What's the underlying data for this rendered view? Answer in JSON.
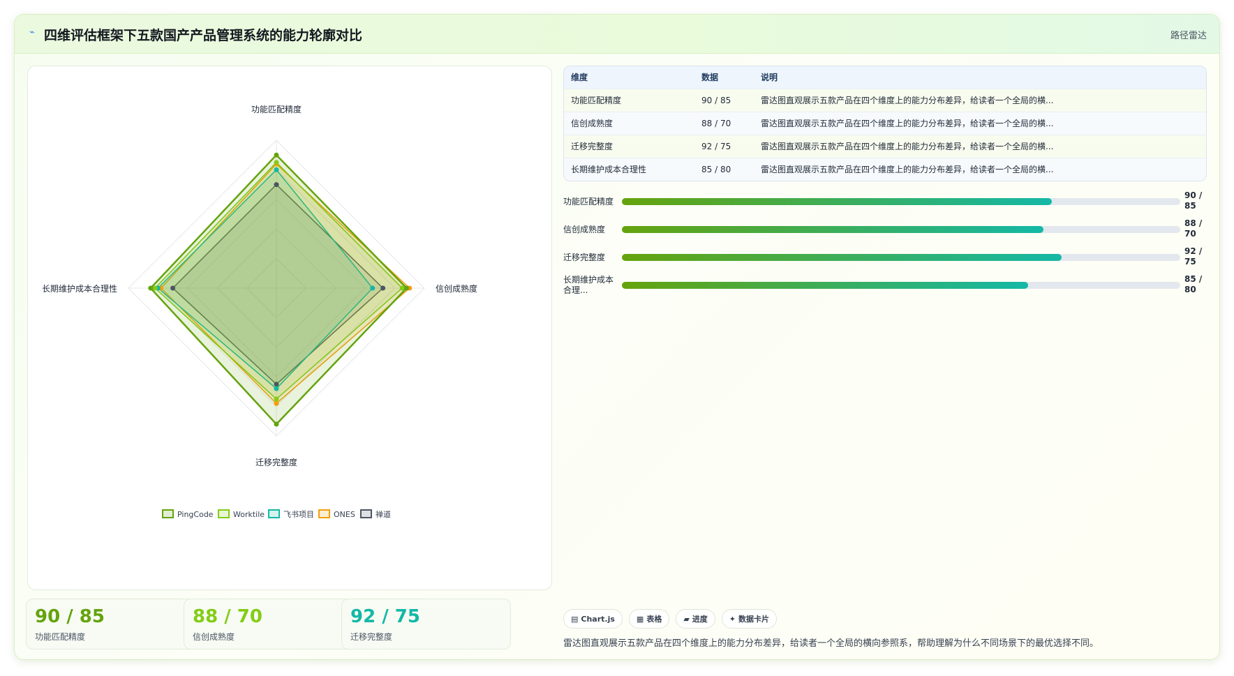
{
  "header": {
    "icon": "pulse-icon",
    "title": "四维评估框架下五款国产产品管理系统的能力轮廓对比",
    "tag": "路径雷达"
  },
  "chart_data": {
    "type": "radar",
    "axes": [
      "功能匹配精度",
      "信创成熟度",
      "迁移完整度",
      "长期维护成本合理性"
    ],
    "range": [
      0,
      100
    ],
    "rings": 5,
    "legend_position": "bottom",
    "series": [
      {
        "name": "PingCode",
        "values": [
          90,
          88,
          92,
          85
        ],
        "color": "#65a30d"
      },
      {
        "name": "Worktile",
        "values": [
          85,
          85,
          75,
          82
        ],
        "color": "#84cc16"
      },
      {
        "name": "飞书项目",
        "values": [
          80,
          65,
          68,
          80
        ],
        "color": "#14b8a6"
      },
      {
        "name": "ONES",
        "values": [
          84,
          90,
          78,
          78
        ],
        "color": "#f59e0b"
      },
      {
        "name": "禅道",
        "values": [
          70,
          72,
          65,
          70
        ],
        "color": "#4b5563"
      }
    ]
  },
  "table": {
    "headers": [
      "维度",
      "数据",
      "说明"
    ],
    "rows": [
      [
        "功能匹配精度",
        "90 / 85",
        "雷达图直观展示五款产品在四个维度上的能力分布差异，给读者一个全局的横..."
      ],
      [
        "信创成熟度",
        "88 / 70",
        "雷达图直观展示五款产品在四个维度上的能力分布差异，给读者一个全局的横..."
      ],
      [
        "迁移完整度",
        "92 / 75",
        "雷达图直观展示五款产品在四个维度上的能力分布差异，给读者一个全局的横..."
      ],
      [
        "长期维护成本合理性",
        "85 / 80",
        "雷达图直观展示五款产品在四个维度上的能力分布差异，给读者一个全局的横..."
      ]
    ]
  },
  "progress": [
    {
      "label": "功能匹配精度",
      "value_text": "90 / 85",
      "fraction": 0.77
    },
    {
      "label": "信创成熟度",
      "value_text": "88 / 70",
      "fraction": 0.755
    },
    {
      "label": "迁移完整度",
      "value_text": "92 / 75",
      "fraction": 0.787
    },
    {
      "label": "长期维护成本合理性",
      "display_label": "长期维护成本合理...",
      "value_text": "85 / 80",
      "fraction": 0.728
    }
  ],
  "stats": [
    {
      "value": "90 / 85",
      "label": "功能匹配精度",
      "color": "#65a30d"
    },
    {
      "value": "88 / 70",
      "label": "信创成熟度",
      "color": "#84cc16"
    },
    {
      "value": "92 / 75",
      "label": "迁移完整度",
      "color": "#14b8a6"
    }
  ],
  "chips": [
    {
      "icon": "chart-icon",
      "label": "Chart.js"
    },
    {
      "icon": "table-icon",
      "label": "表格"
    },
    {
      "icon": "progress-icon",
      "label": "进度"
    },
    {
      "icon": "card-icon",
      "label": "数据卡片"
    }
  ],
  "note": "雷达图直观展示五款产品在四个维度上的能力分布差异，给读者一个全局的横向参照系，帮助理解为什么不同场景下的最优选择不同。"
}
